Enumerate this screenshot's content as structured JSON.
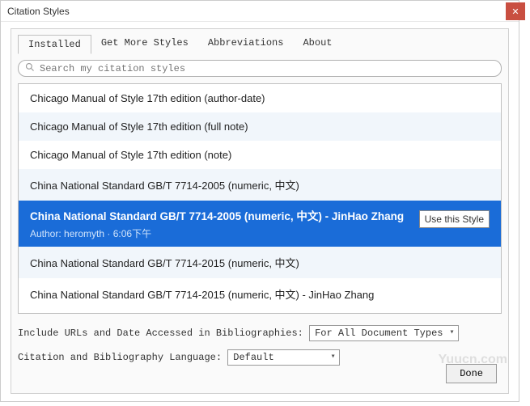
{
  "window": {
    "title": "Citation Styles"
  },
  "tabs": {
    "installed": "Installed",
    "get_more": "Get More Styles",
    "abbreviations": "Abbreviations",
    "about": "About"
  },
  "search": {
    "placeholder": "Search my citation styles"
  },
  "styles": [
    "Chicago Manual of Style 17th edition (author-date)",
    "Chicago Manual of Style 17th edition (full note)",
    "Chicago Manual of Style 17th edition (note)",
    "China National Standard GB/T 7714-2005 (numeric, 中文)",
    "China National Standard GB/T 7714-2005 (numeric, 中文) - JinHao Zhang",
    "China National Standard GB/T 7714-2015 (numeric, 中文)",
    "China National Standard GB/T 7714-2015 (numeric, 中文) - JinHao Zhang"
  ],
  "selected": {
    "meta": "Author: heromyth · 6:06下午",
    "use_label": "Use this Style"
  },
  "options": {
    "include_urls_label": "Include URLs and Date Accessed in Bibliographies:",
    "include_urls_value": "For All Document Types",
    "lang_label": "Citation and Bibliography Language:",
    "lang_value": "Default"
  },
  "done_label": "Done",
  "watermark": "Yuucn.com"
}
